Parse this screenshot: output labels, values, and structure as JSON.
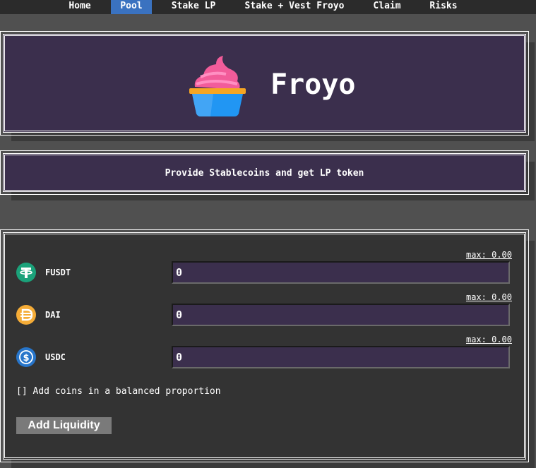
{
  "nav": {
    "items": [
      {
        "label": "Home",
        "active": false
      },
      {
        "label": "Pool",
        "active": true
      },
      {
        "label": "Stake LP",
        "active": false
      },
      {
        "label": "Stake + Vest Froyo",
        "active": false
      },
      {
        "label": "Claim",
        "active": false
      },
      {
        "label": "Risks",
        "active": false
      }
    ]
  },
  "hero": {
    "title": "Froyo",
    "logo_icon": "frozen-yogurt-cup-icon"
  },
  "subtitle": "Provide Stablecoins and get LP token",
  "coins": [
    {
      "symbol": "FUSDT",
      "max_label": "max: 0.00",
      "value": "0",
      "icon": "tether-icon",
      "color": "#1ba27a"
    },
    {
      "symbol": "DAI",
      "max_label": "max: 0.00",
      "value": "0",
      "icon": "dai-icon",
      "color": "#f5ac37"
    },
    {
      "symbol": "USDC",
      "max_label": "max: 0.00",
      "value": "0",
      "icon": "usdc-icon",
      "color": "#2775ca"
    }
  ],
  "balanced_checkbox_label": "[] Add coins in a balanced proportion",
  "add_liquidity_label": "Add Liquidity",
  "colors": {
    "nav_bg": "#2b2b2b",
    "nav_active": "#3a72c0",
    "panel_purple": "#3b2f4d",
    "form_bg": "#333333",
    "page_bg": "#505050"
  }
}
